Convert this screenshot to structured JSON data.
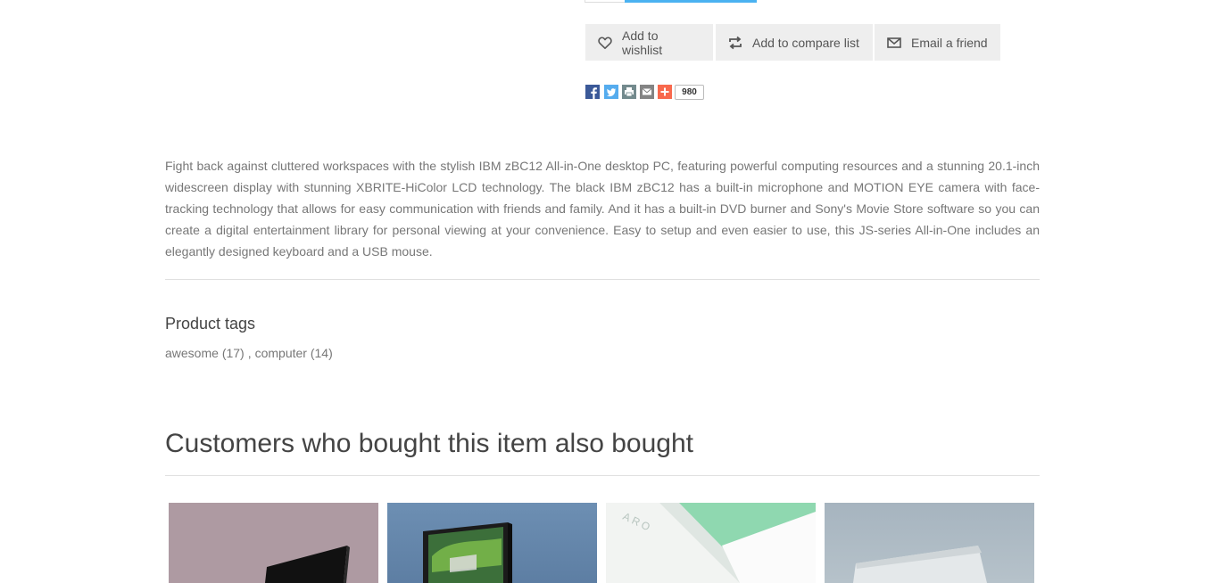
{
  "actions": {
    "wishlist_label": "Add to wishlist",
    "compare_label": "Add to compare list",
    "email_label": "Email a friend"
  },
  "share": {
    "icons": [
      "facebook-icon",
      "twitter-icon",
      "print-icon",
      "email-icon",
      "more-icon"
    ],
    "count": "980",
    "colors": {
      "facebook": "#3b5998",
      "twitter": "#55acee",
      "print": "#738a8d",
      "email": "#848484",
      "more": "#f8694d"
    }
  },
  "description": "Fight back against cluttered workspaces with the stylish IBM zBC12 All-in-One desktop PC, featuring powerful computing resources and a stunning 20.1-inch widescreen display with stunning XBRITE-HiColor LCD technology. The black IBM zBC12 has a built-in microphone and MOTION EYE camera with face-tracking technology that allows for easy communication with friends and family. And it has a built-in DVD burner and Sony's Movie Store software so you can create a digital entertainment library for personal viewing at your convenience. Easy to setup and even easier to use, this JS-series All-in-One includes an elegantly designed keyboard and a USB mouse.",
  "tags": {
    "title": "Product tags",
    "items": [
      {
        "label": "awesome",
        "count": "(17)"
      },
      {
        "label": "computer",
        "count": "(14)"
      }
    ],
    "separator": ","
  },
  "also_bought": {
    "title": "Customers who bought this item also bought"
  },
  "colors": {
    "accent": "#4ab2f1",
    "button_bg": "#eeeeee"
  }
}
